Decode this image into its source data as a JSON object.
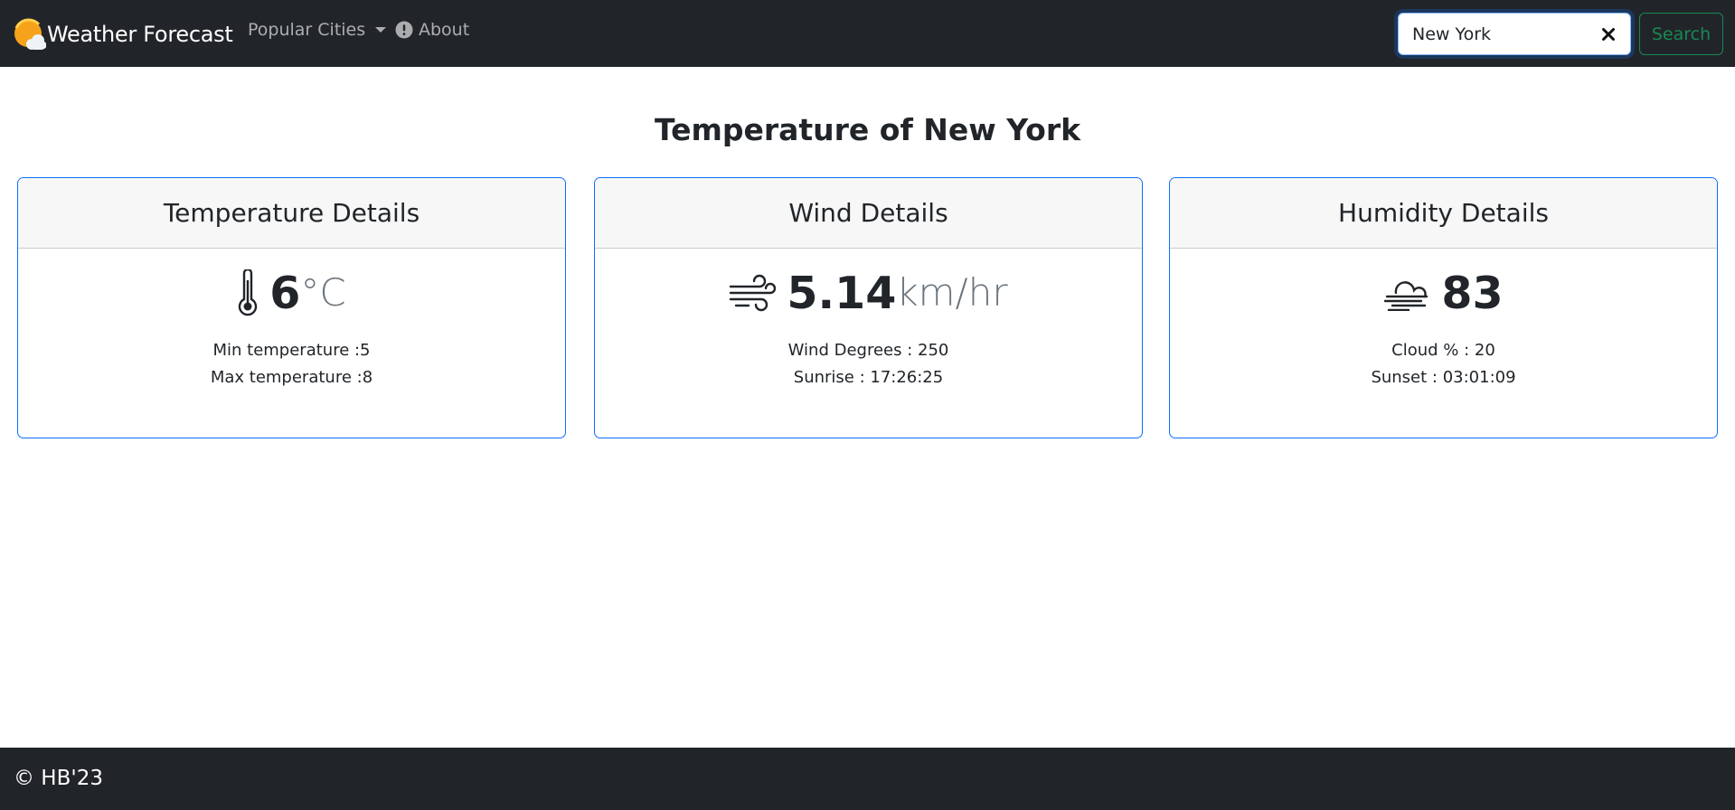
{
  "navbar": {
    "brand": "Weather Forecast",
    "menu_popular": "Popular Cities",
    "menu_about": "About"
  },
  "search": {
    "value": "New York",
    "button": "Search"
  },
  "page_title": "Temperature of New York",
  "cards": {
    "temperature": {
      "title": "Temperature Details",
      "value": "6",
      "unit": "°C",
      "detail1": "Min temperature :5",
      "detail2": "Max temperature :8"
    },
    "wind": {
      "title": "Wind Details",
      "value": "5.14",
      "unit": "km/hr",
      "detail1": "Wind Degrees : 250",
      "detail2": "Sunrise : 17:26:25"
    },
    "humidity": {
      "title": "Humidity Details",
      "value": "83",
      "unit": "",
      "detail1": "Cloud % : 20",
      "detail2": "Sunset : 03:01:09"
    }
  },
  "footer": "© HB'23",
  "icons": {
    "brand": "sun-cloud-icon",
    "about": "info-circle-icon",
    "clear": "close-icon",
    "temperature": "thermometer-icon",
    "wind": "wind-icon",
    "humidity": "cloud-haze-icon"
  },
  "colors": {
    "navbar_bg": "#212529",
    "card_border": "#0d6efd",
    "search_button": "#198754",
    "sun": "#f7a21b"
  }
}
